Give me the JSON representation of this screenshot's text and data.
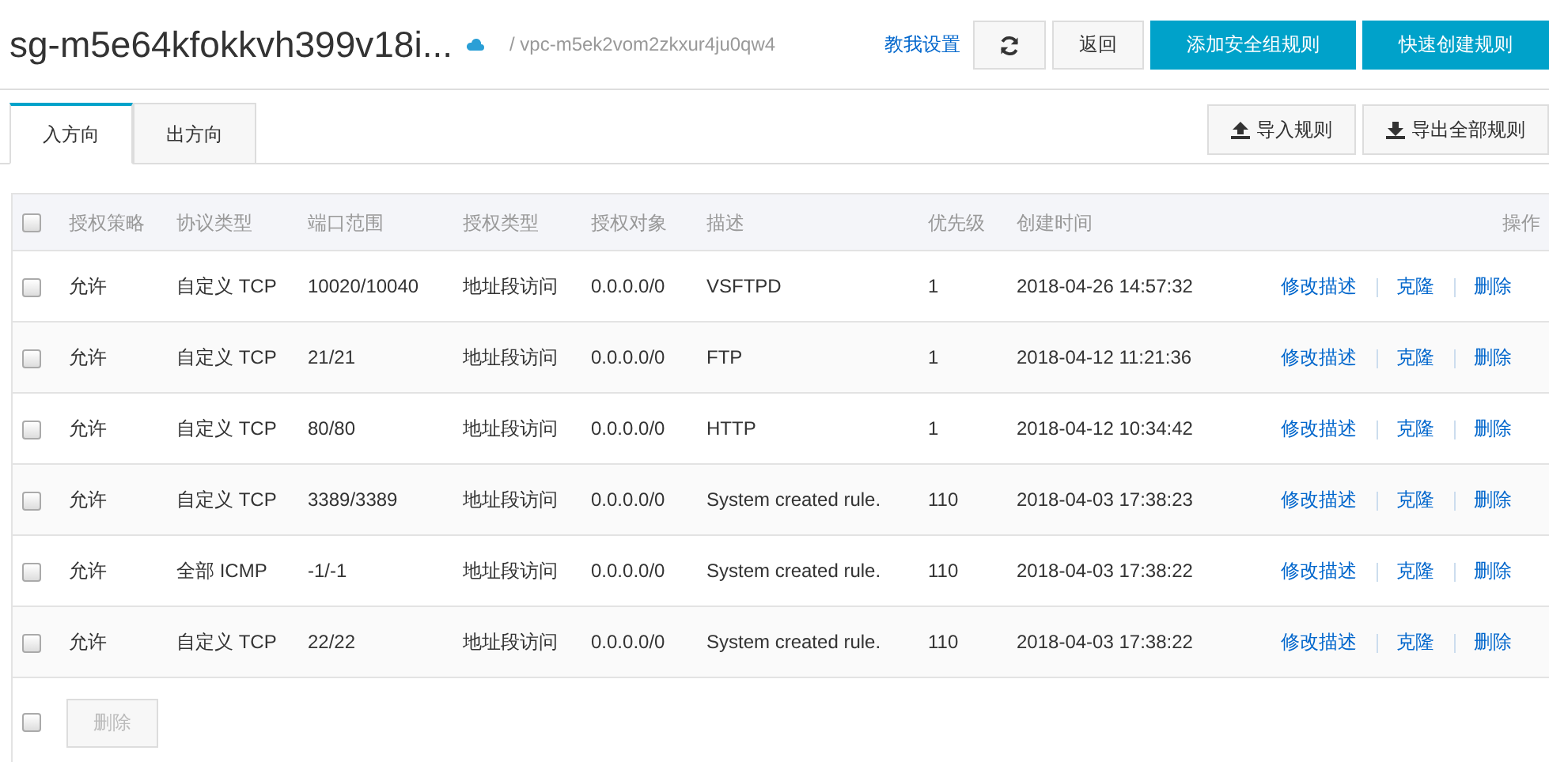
{
  "header": {
    "title": "sg-m5e64kfokkvh399v18i...",
    "vpc": "/ vpc-m5ek2vom2zkxur4ju0qw4",
    "help_link": "教我设置",
    "buttons": [
      {
        "kind": "refresh"
      },
      {
        "kind": "default",
        "label": "返回"
      },
      {
        "kind": "primary",
        "label": "添加安全组规则"
      },
      {
        "kind": "primary",
        "label": "快速创建规则"
      }
    ]
  },
  "tabs": [
    {
      "label": "入方向",
      "selected": true
    },
    {
      "label": "出方向",
      "selected": false
    }
  ],
  "tools": [
    {
      "kind": "upload",
      "label": "导入规则"
    },
    {
      "kind": "download",
      "label": "导出全部规则"
    }
  ],
  "table": {
    "select_all": {
      "checked": false
    },
    "columns": [
      "授权策略",
      "协议类型",
      "端口范围",
      "授权类型",
      "授权对象",
      "描述",
      "优先级",
      "创建时间",
      "操作"
    ],
    "rows": [
      {
        "checked": false,
        "cells": [
          "允许",
          "自定义 TCP",
          "10020/10040",
          "地址段访问",
          "0.0.0.0/0",
          "VSFTPD",
          "1",
          "2018-04-26 14:57:32"
        ],
        "actions": [
          "修改描述",
          "克隆",
          "删除"
        ]
      },
      {
        "checked": false,
        "cells": [
          "允许",
          "自定义 TCP",
          "21/21",
          "地址段访问",
          "0.0.0.0/0",
          "FTP",
          "1",
          "2018-04-12 11:21:36"
        ],
        "actions": [
          "修改描述",
          "克隆",
          "删除"
        ]
      },
      {
        "checked": false,
        "cells": [
          "允许",
          "自定义 TCP",
          "80/80",
          "地址段访问",
          "0.0.0.0/0",
          "HTTP",
          "1",
          "2018-04-12 10:34:42"
        ],
        "actions": [
          "修改描述",
          "克隆",
          "删除"
        ]
      },
      {
        "checked": false,
        "cells": [
          "允许",
          "自定义 TCP",
          "3389/3389",
          "地址段访问",
          "0.0.0.0/0",
          "System created rule.",
          "110",
          "2018-04-03 17:38:23"
        ],
        "actions": [
          "修改描述",
          "克隆",
          "删除"
        ]
      },
      {
        "checked": false,
        "cells": [
          "允许",
          "全部 ICMP",
          "-1/-1",
          "地址段访问",
          "0.0.0.0/0",
          "System created rule.",
          "110",
          "2018-04-03 17:38:22"
        ],
        "actions": [
          "修改描述",
          "克隆",
          "删除"
        ]
      },
      {
        "checked": false,
        "cells": [
          "允许",
          "自定义 TCP",
          "22/22",
          "地址段访问",
          "0.0.0.0/0",
          "System created rule.",
          "110",
          "2018-04-03 17:38:22"
        ],
        "actions": [
          "修改描述",
          "克隆",
          "删除"
        ]
      }
    ],
    "footer": {
      "checked": false,
      "button": {
        "label": "删除",
        "disabled": true
      }
    }
  }
}
